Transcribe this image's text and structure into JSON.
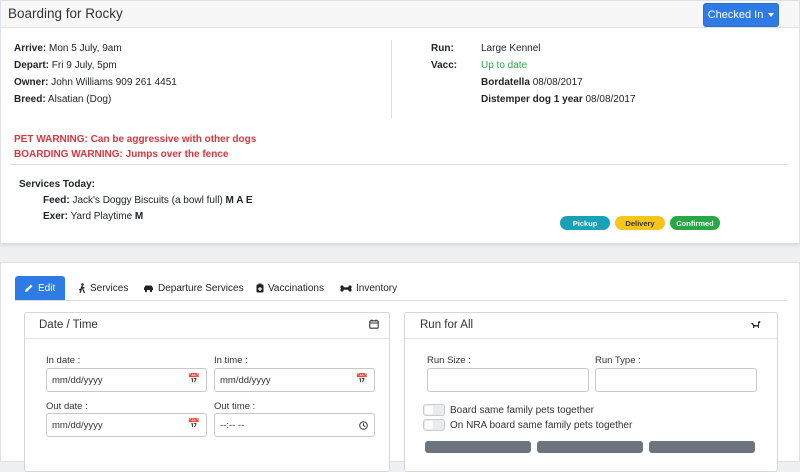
{
  "header": {
    "title": "Boarding for Rocky",
    "status_button": "Checked In"
  },
  "details": {
    "arrive_label": "Arrive:",
    "arrive_value": "Mon 5 July, 9am",
    "depart_label": "Depart:",
    "depart_value": "Fri 9 July, 5pm",
    "owner_label": "Owner:",
    "owner_value": "John Williams 909 261 4451",
    "breed_label": "Breed:",
    "breed_value": "Alsatian (Dog)",
    "run_label": "Run:",
    "run_value": "Large Kennel",
    "vacc_label": "Vacc:",
    "vacc_value": "Up to date",
    "vacc_1_name": "Bordatella",
    "vacc_1_date": "08/08/2017",
    "vacc_2_name": "Distemper dog 1 year",
    "vacc_2_date": "08/08/2017"
  },
  "warnings": {
    "pet": "PET WARNING: Can be aggressive with other dogs",
    "boarding": "BOARDING WARNING: Jumps over the fence"
  },
  "services": {
    "heading": "Services Today:",
    "feed_label": "Feed:",
    "feed_value": "Jack's Doggy Biscuits (a bowl full)",
    "feed_times": "M A E",
    "exer_label": "Exer:",
    "exer_value": "Yard Playtime",
    "exer_times": "M"
  },
  "badges": {
    "pickup": "Pickup",
    "delivery": "Delivery",
    "confirmed": "Confirmed"
  },
  "colors": {
    "accent": "#2e7be6",
    "warning": "#d9363e",
    "success": "#28a745",
    "info": "#17a2b8",
    "caution": "#f5c518"
  },
  "tabs": {
    "edit": "Edit",
    "services": "Services",
    "departure": "Departure Services",
    "vaccinations": "Vaccinations",
    "inventory": "Inventory"
  },
  "datetime_panel": {
    "title": "Date / Time",
    "in_date_label": "In date :",
    "in_date_placeholder": "mm/dd/yyyy",
    "in_time_label": "In time :",
    "in_time_placeholder": "mm/dd/yyyy",
    "out_date_label": "Out date :",
    "out_date_placeholder": "mm/dd/yyyy",
    "out_time_label": "Out time :",
    "out_time_placeholder": "--:-- --"
  },
  "run_panel": {
    "title": "Run for All",
    "run_size_label": "Run Size :",
    "run_type_label": "Run Type :",
    "toggle_1": "Board same family pets together",
    "toggle_2": "On NRA board same family pets together"
  }
}
